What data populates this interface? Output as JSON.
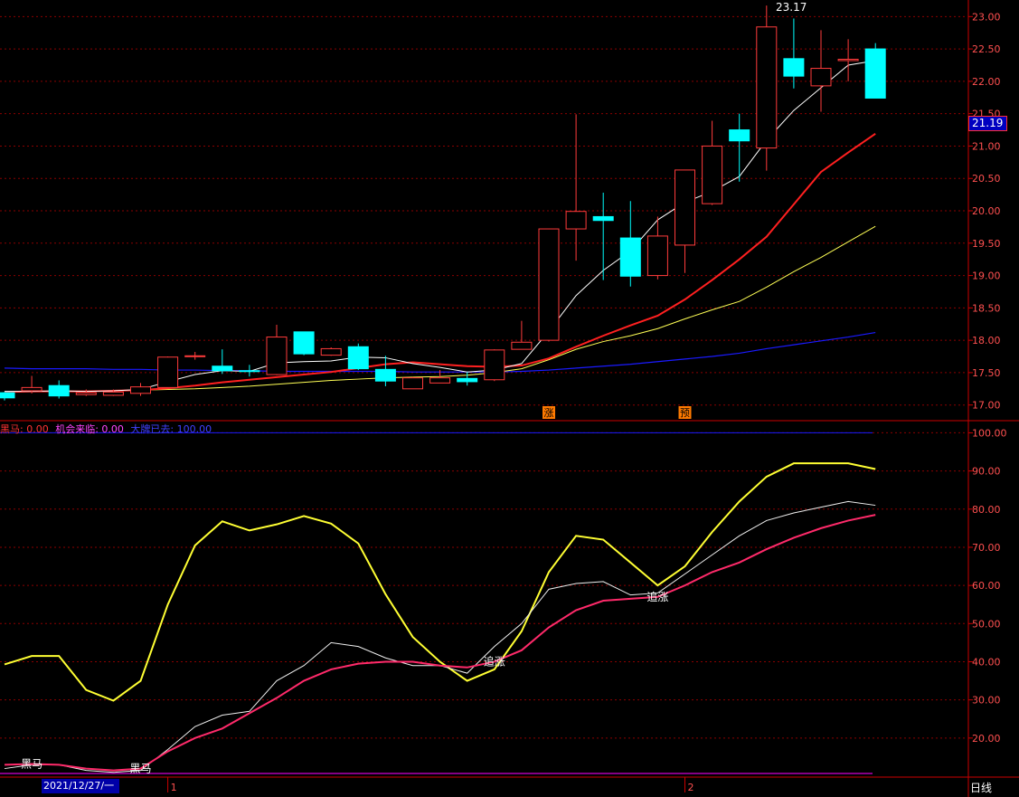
{
  "colors": {
    "up": "#ff3b3b",
    "down": "#00ffff",
    "ma5": "#ffffff",
    "ma10": "#ff2020",
    "ma20": "#ffff55",
    "ma60": "#1a1aff",
    "grid": "#8b0000",
    "axis": "#cc0000",
    "osc_yellow": "#ffff33",
    "osc_white": "#f0f0f0",
    "osc_pink": "#ff2a6a",
    "osc_top": "#1a1aff",
    "osc_bottom": "#b000b0",
    "label_orange": "#ff7a00",
    "legend_red": "#ff3333",
    "legend_magenta": "#ff44ff",
    "legend_blue": "#4040ff"
  },
  "price_label": "21.19",
  "max_label": "23.17",
  "date_label": "2021/12/27/一",
  "period_label": "日线",
  "legend": [
    {
      "text": "黑马: 0.00",
      "color": "#ff3333"
    },
    {
      "text": "机会来临: 0.00",
      "color": "#ff44ff"
    },
    {
      "text": "大牌已去: 100.00",
      "color": "#4040ff"
    }
  ],
  "chart_data": [
    {
      "type": "candlestick",
      "ylim": [
        16.8,
        23.2
      ],
      "y_ticks": [
        "17.00",
        "17.50",
        "18.00",
        "18.50",
        "19.00",
        "19.50",
        "20.00",
        "20.50",
        "21.00",
        "21.50",
        "22.00",
        "22.50",
        "23.00"
      ],
      "candles": [
        {
          "o": 17.19,
          "c": 17.11,
          "h": 17.2,
          "l": 17.07
        },
        {
          "o": 17.22,
          "c": 17.27,
          "h": 17.45,
          "l": 17.18
        },
        {
          "o": 17.3,
          "c": 17.14,
          "h": 17.38,
          "l": 17.1
        },
        {
          "o": 17.16,
          "c": 17.19,
          "h": 17.24,
          "l": 17.14
        },
        {
          "o": 17.15,
          "c": 17.2,
          "h": 17.24,
          "l": 17.14
        },
        {
          "o": 17.18,
          "c": 17.28,
          "h": 17.34,
          "l": 17.14
        },
        {
          "o": 17.27,
          "c": 17.74,
          "h": 17.75,
          "l": 17.26
        },
        {
          "o": 17.76,
          "c": 17.76,
          "h": 17.82,
          "l": 17.7
        },
        {
          "o": 17.6,
          "c": 17.53,
          "h": 17.86,
          "l": 17.48
        },
        {
          "o": 17.53,
          "c": 17.52,
          "h": 17.62,
          "l": 17.44
        },
        {
          "o": 17.47,
          "c": 18.05,
          "h": 18.24,
          "l": 17.46
        },
        {
          "o": 18.13,
          "c": 17.79,
          "h": 18.13,
          "l": 17.77
        },
        {
          "o": 17.77,
          "c": 17.87,
          "h": 17.89,
          "l": 17.76
        },
        {
          "o": 17.9,
          "c": 17.56,
          "h": 17.95,
          "l": 17.54
        },
        {
          "o": 17.55,
          "c": 17.37,
          "h": 17.76,
          "l": 17.29
        },
        {
          "o": 17.25,
          "c": 17.42,
          "h": 17.43,
          "l": 17.25
        },
        {
          "o": 17.34,
          "c": 17.42,
          "h": 17.54,
          "l": 17.34
        },
        {
          "o": 17.41,
          "c": 17.36,
          "h": 17.51,
          "l": 17.3
        },
        {
          "o": 17.39,
          "c": 17.85,
          "h": 17.86,
          "l": 17.37
        },
        {
          "o": 17.86,
          "c": 17.97,
          "h": 18.3,
          "l": 17.86
        },
        {
          "o": 18.0,
          "c": 19.72,
          "h": 19.72,
          "l": 17.98
        },
        {
          "o": 19.72,
          "c": 19.99,
          "h": 21.49,
          "l": 19.23
        },
        {
          "o": 19.91,
          "c": 19.85,
          "h": 20.28,
          "l": 18.93
        },
        {
          "o": 19.58,
          "c": 18.99,
          "h": 20.15,
          "l": 18.83
        },
        {
          "o": 19.0,
          "c": 19.61,
          "h": 19.91,
          "l": 18.94
        },
        {
          "o": 19.47,
          "c": 20.63,
          "h": 20.63,
          "l": 19.04
        },
        {
          "o": 20.11,
          "c": 21.0,
          "h": 21.39,
          "l": 20.09
        },
        {
          "o": 21.25,
          "c": 21.08,
          "h": 21.5,
          "l": 20.45
        },
        {
          "o": 20.97,
          "c": 22.84,
          "h": 23.17,
          "l": 20.62
        },
        {
          "o": 22.35,
          "c": 22.08,
          "h": 22.97,
          "l": 21.89
        },
        {
          "o": 21.93,
          "c": 22.2,
          "h": 22.79,
          "l": 21.53
        },
        {
          "o": 22.32,
          "c": 22.34,
          "h": 22.65,
          "l": 22.0
        },
        {
          "o": 22.5,
          "c": 21.74,
          "h": 22.59,
          "l": 21.74
        }
      ],
      "ma5": [
        17.21,
        17.21,
        17.22,
        17.21,
        17.22,
        17.24,
        17.36,
        17.47,
        17.53,
        17.52,
        17.65,
        17.67,
        17.68,
        17.74,
        17.73,
        17.64,
        17.58,
        17.51,
        17.54,
        17.64,
        18.14,
        18.69,
        19.08,
        19.38,
        19.86,
        20.13,
        20.3,
        20.53,
        21.09,
        21.55,
        21.9,
        22.25,
        22.32
      ],
      "ma10": [
        17.2,
        17.21,
        17.21,
        17.21,
        17.22,
        17.23,
        17.26,
        17.3,
        17.35,
        17.39,
        17.43,
        17.47,
        17.51,
        17.57,
        17.63,
        17.66,
        17.63,
        17.6,
        17.59,
        17.61,
        17.72,
        17.9,
        18.07,
        18.23,
        18.38,
        18.63,
        18.93,
        19.25,
        19.6,
        20.1,
        20.6,
        20.9,
        21.19
      ],
      "ma20": [
        17.2,
        17.21,
        17.21,
        17.21,
        17.22,
        17.23,
        17.24,
        17.25,
        17.27,
        17.29,
        17.32,
        17.35,
        17.38,
        17.4,
        17.42,
        17.43,
        17.44,
        17.46,
        17.5,
        17.56,
        17.7,
        17.86,
        17.98,
        18.07,
        18.18,
        18.33,
        18.47,
        18.6,
        18.82,
        19.06,
        19.28,
        19.52,
        19.76
      ],
      "ma60": [
        17.57,
        17.56,
        17.56,
        17.56,
        17.55,
        17.55,
        17.54,
        17.54,
        17.53,
        17.53,
        17.52,
        17.52,
        17.52,
        17.52,
        17.52,
        17.51,
        17.51,
        17.51,
        17.51,
        17.52,
        17.54,
        17.57,
        17.6,
        17.63,
        17.67,
        17.71,
        17.75,
        17.8,
        17.87,
        17.93,
        17.99,
        18.05,
        18.12
      ],
      "markers": [
        {
          "index": 20,
          "text": "涨"
        },
        {
          "index": 25,
          "text": "预"
        }
      ]
    },
    {
      "type": "line",
      "ylim": [
        10,
        102
      ],
      "y_ticks": [
        "20.00",
        "30.00",
        "40.00",
        "50.00",
        "60.00",
        "70.00",
        "80.00",
        "90.00",
        "100.00"
      ],
      "reference_line": 100,
      "series": [
        {
          "color_key": "osc_yellow",
          "values": [
            39.3,
            41.5,
            41.5,
            32.6,
            29.8,
            35.0,
            55.0,
            70.5,
            76.8,
            74.4,
            76.0,
            78.2,
            76.2,
            71.0,
            57.7,
            46.5,
            40.0,
            35.0,
            38.0,
            48.0,
            63.5,
            73.0,
            72.0,
            66.0,
            60.0,
            65.0,
            74.0,
            82.0,
            88.5,
            92.0,
            92.0,
            92.0,
            90.5
          ]
        },
        {
          "color_key": "osc_white",
          "values": [
            12.0,
            13.0,
            13.0,
            11.5,
            11.0,
            11.5,
            17.0,
            23.0,
            26.0,
            27.0,
            35.0,
            39.0,
            45.0,
            44.0,
            41.0,
            39.0,
            39.0,
            37.0,
            44.0,
            50.0,
            59.0,
            60.5,
            61.0,
            57.5,
            58.0,
            63.0,
            68.0,
            73.0,
            77.0,
            79.0,
            80.5,
            82.0,
            81.0
          ]
        },
        {
          "color_key": "osc_pink",
          "values": [
            13.0,
            13.2,
            13.0,
            12.0,
            11.5,
            12.0,
            16.5,
            20.0,
            22.5,
            26.5,
            30.5,
            35.0,
            38.0,
            39.5,
            40.0,
            40.0,
            39.0,
            38.5,
            40.0,
            43.0,
            49.0,
            53.5,
            56.0,
            56.5,
            57.0,
            60.0,
            63.5,
            66.0,
            69.5,
            72.5,
            75.0,
            77.0,
            78.5
          ]
        }
      ],
      "labels": [
        {
          "index": 1,
          "text": "黑马"
        },
        {
          "index": 5,
          "text": "黑马"
        },
        {
          "index": 18,
          "text": "追涨"
        },
        {
          "index": 24,
          "text": "追涨"
        }
      ]
    }
  ],
  "x_labels": [
    {
      "index": 6,
      "text": "1"
    },
    {
      "index": 25,
      "text": "2"
    }
  ]
}
